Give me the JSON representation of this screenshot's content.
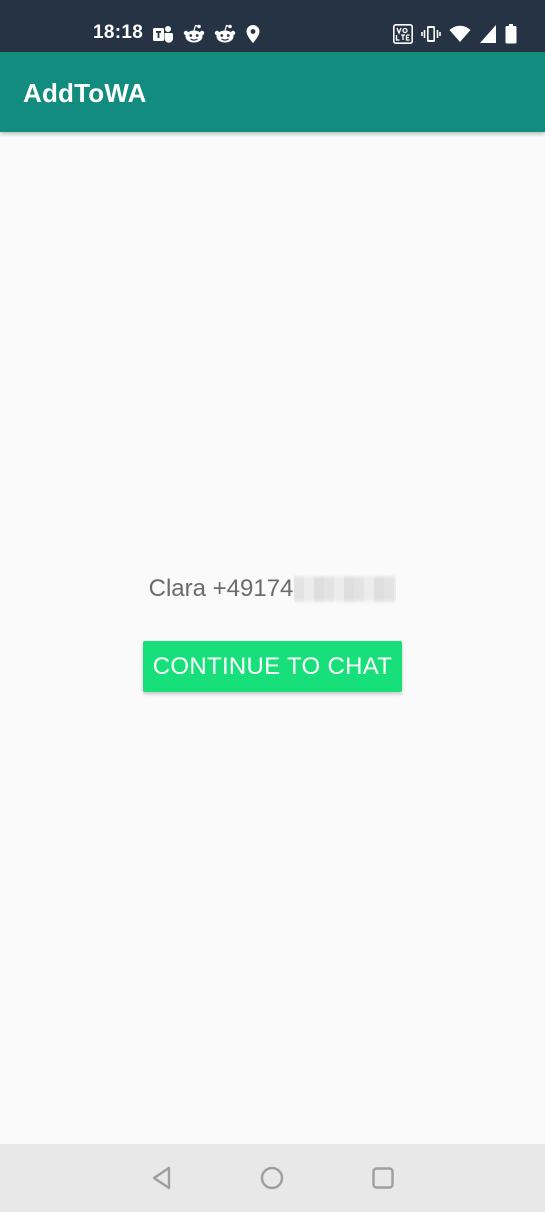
{
  "status_bar": {
    "time": "18:18",
    "left_icons": [
      "teams-icon",
      "reddit-icon",
      "reddit-icon",
      "location-icon"
    ],
    "right_icons": [
      "volte-icon",
      "vibrate-icon",
      "wifi-icon",
      "signal-icon",
      "battery-icon"
    ]
  },
  "app_bar": {
    "title": "AddToWA",
    "background_color": "#128c7e"
  },
  "main": {
    "contact_text": "Clara +49174",
    "button_label": "CONTINUE TO CHAT",
    "button_color": "#17e07a"
  },
  "nav_bar": {
    "icons": [
      "back-triangle-icon",
      "home-circle-icon",
      "recents-square-icon"
    ]
  }
}
